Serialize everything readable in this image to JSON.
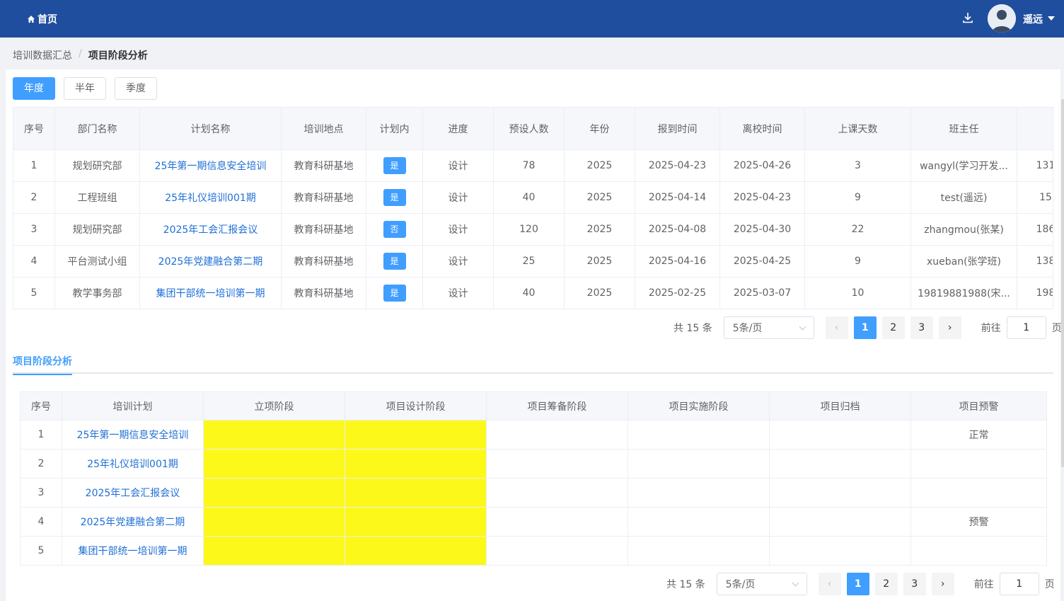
{
  "topbar": {
    "home_label": "首页",
    "user_name": "遥远"
  },
  "breadcrumb": {
    "parent": "培训数据汇总",
    "separator": "/",
    "current": "项目阶段分析"
  },
  "period_buttons": [
    {
      "label": "年度"
    },
    {
      "label": "半年"
    },
    {
      "label": "季度"
    }
  ],
  "table1": {
    "headers": [
      "序号",
      "部门名称",
      "计划名称",
      "培训地点",
      "计划内",
      "进度",
      "预设人数",
      "年份",
      "报到时间",
      "离校时间",
      "上课天数",
      "班主任",
      ""
    ],
    "rows": [
      {
        "no": "1",
        "dept": "规划研究部",
        "plan": "25年第一期信息安全培训",
        "place": "教育科研基地",
        "inplan": "是",
        "progress": "设计",
        "people": "78",
        "year": "2025",
        "start": "2025-04-23",
        "end": "2025-04-26",
        "days": "3",
        "teacher": "wangyl(学习开发...",
        "extra": "131"
      },
      {
        "no": "2",
        "dept": "工程班组",
        "plan": "25年礼仪培训001期",
        "place": "教育科研基地",
        "inplan": "是",
        "progress": "设计",
        "people": "40",
        "year": "2025",
        "start": "2025-04-14",
        "end": "2025-04-23",
        "days": "9",
        "teacher": "test(遥远)",
        "extra": "15"
      },
      {
        "no": "3",
        "dept": "规划研究部",
        "plan": "2025年工会汇报会议",
        "place": "教育科研基地",
        "inplan": "否",
        "progress": "设计",
        "people": "120",
        "year": "2025",
        "start": "2025-04-08",
        "end": "2025-04-30",
        "days": "22",
        "teacher": "zhangmou(张某)",
        "extra": "186"
      },
      {
        "no": "4",
        "dept": "平台测试小组",
        "plan": "2025年党建融合第二期",
        "place": "教育科研基地",
        "inplan": "是",
        "progress": "设计",
        "people": "25",
        "year": "2025",
        "start": "2025-04-16",
        "end": "2025-04-25",
        "days": "9",
        "teacher": "xueban(张学班)",
        "extra": "138"
      },
      {
        "no": "5",
        "dept": "教学事务部",
        "plan": "集团干部统一培训第一期",
        "place": "教育科研基地",
        "inplan": "是",
        "progress": "设计",
        "people": "40",
        "year": "2025",
        "start": "2025-02-25",
        "end": "2025-03-07",
        "days": "10",
        "teacher": "19819881988(宋...",
        "extra": "198"
      }
    ]
  },
  "pager1": {
    "total": "共 15 条",
    "page_size": "5条/页",
    "pages": [
      "1",
      "2",
      "3"
    ],
    "goto_label": "前往",
    "goto_value": "1",
    "page_unit": "页"
  },
  "section_tab": "项目阶段分析",
  "table2": {
    "headers": [
      "序号",
      "培训计划",
      "立项阶段",
      "项目设计阶段",
      "项目筹备阶段",
      "项目实施阶段",
      "项目归档",
      "项目预警"
    ],
    "rows": [
      {
        "no": "1",
        "plan": "25年第一期信息安全培训",
        "warning": "正常"
      },
      {
        "no": "2",
        "plan": "25年礼仪培训001期",
        "warning": ""
      },
      {
        "no": "3",
        "plan": "2025年工会汇报会议",
        "warning": ""
      },
      {
        "no": "4",
        "plan": "2025年党建融合第二期",
        "warning": "预警"
      },
      {
        "no": "5",
        "plan": "集团干部统一培训第一期",
        "warning": ""
      }
    ],
    "highlight_color": "#fcf81a"
  },
  "pager2": {
    "total": "共 15 条",
    "page_size": "5条/页",
    "pages": [
      "1",
      "2",
      "3"
    ],
    "goto_label": "前往",
    "goto_value": "1",
    "page_unit": "页"
  },
  "colors": {
    "header_bg": "#1f4e9f",
    "primary": "#409eff",
    "link": "#1f6fd6"
  }
}
